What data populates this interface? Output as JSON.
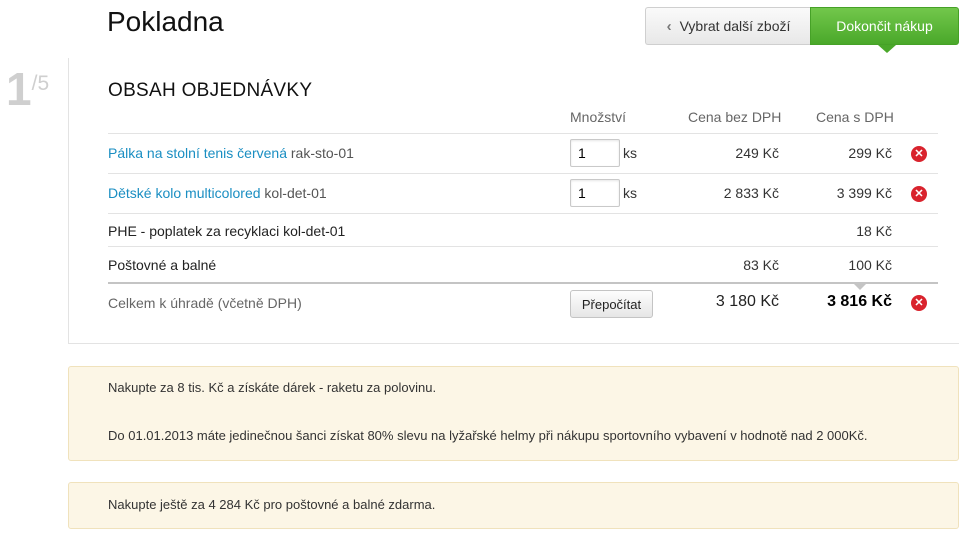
{
  "header": {
    "title": "Pokladna",
    "back_button": "Vybrat další zboží",
    "finish_button": "Dokončit nákup"
  },
  "step": {
    "current": "1",
    "separator": "/",
    "total": "5"
  },
  "order": {
    "section_title": "OBSAH OBJEDNÁVKY",
    "columns": {
      "quantity": "Množství",
      "price_no_vat": "Cena bez DPH",
      "price_vat": "Cena s DPH"
    },
    "items": [
      {
        "name": "Pálka na stolní tenis červená",
        "code": "rak-sto-01",
        "qty": "1",
        "unit": "ks",
        "price_no_vat": "249 Kč",
        "price_vat": "299 Kč"
      },
      {
        "name": "Dětské kolo multicolored",
        "code": "kol-det-01",
        "qty": "1",
        "unit": "ks",
        "price_no_vat": "2 833 Kč",
        "price_vat": "3 399 Kč"
      }
    ],
    "fee": {
      "label": "PHE - poplatek za recyklaci kol-det-01",
      "price_vat": "18 Kč"
    },
    "shipping": {
      "label": "Poštovné a balné",
      "price_no_vat": "83 Kč",
      "price_vat": "100 Kč"
    },
    "total": {
      "label": "Celkem k úhradě (včetně DPH)",
      "recalc_button": "Přepočítat",
      "price_no_vat": "3 180 Kč",
      "price_vat": "3 816 Kč"
    }
  },
  "notices": {
    "promo_1": "Nakupte za 8 tis. Kč a získáte dárek - raketu za polovinu.",
    "promo_2": "Do 01.01.2013 máte jedinečnou šanci získat 80% slevu na lyžařské helmy při nákupu sportovního vybavení v hodnotě nad 2 000Kč.",
    "shipping_info": "Nakupte ještě za 4 284 Kč pro poštovné a balné zdarma."
  },
  "colors": {
    "accent_green": "#4aa82a",
    "link_blue": "#1a8ec2",
    "remove_red": "#d9232d",
    "notice_bg": "#fcf6e6"
  },
  "icons": {
    "back": "chevron-left-icon",
    "remove": "remove-circle-icon"
  }
}
